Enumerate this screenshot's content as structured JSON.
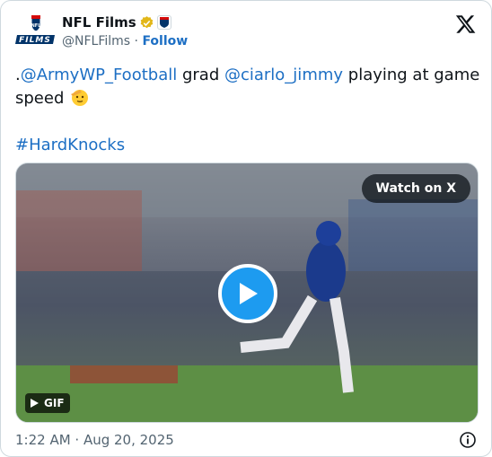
{
  "header": {
    "display_name": "NFL Films",
    "handle": "@NFLFilms",
    "separator": " · ",
    "follow_label": "Follow",
    "verified_color": "#e2b719",
    "link_color": "#1d6fc4"
  },
  "tweet": {
    "prefix": ".",
    "mention1": "@ArmyWP_Football",
    "mid_text": " grad ",
    "mention2": "@ciarlo_jimmy",
    "tail_text": " playing at game speed ",
    "emoji": "saluting-face-emoji",
    "hashtag": "#HardKnocks"
  },
  "media": {
    "watch_label": "Watch on X",
    "gif_label": "GIF",
    "play_color": "#1d9bf0"
  },
  "footer": {
    "timestamp": "1:22 AM · Aug 20, 2025"
  }
}
